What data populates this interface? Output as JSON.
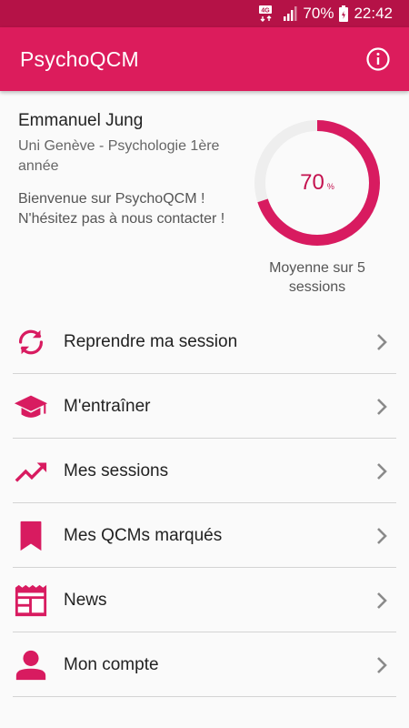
{
  "status_bar": {
    "network": "4G",
    "battery": "70%",
    "time": "22:42"
  },
  "app_bar": {
    "title": "PsychoQCM",
    "info_icon": "info-icon"
  },
  "profile": {
    "name": "Emmanuel Jung",
    "school": "Uni Genève - Psychologie 1ère année",
    "welcome": "Bienvenue sur PsychoQCM ! N'hésitez pas à nous contacter !"
  },
  "progress": {
    "value": 70,
    "unit": "%",
    "label": "Moyenne sur 5 sessions"
  },
  "menu": {
    "items": [
      {
        "label": "Reprendre ma session",
        "icon": "refresh-icon"
      },
      {
        "label": "M'entraîner",
        "icon": "graduation-cap-icon"
      },
      {
        "label": "Mes sessions",
        "icon": "trending-up-icon"
      },
      {
        "label": "Mes QCMs marqués",
        "icon": "bookmark-icon"
      },
      {
        "label": "News",
        "icon": "newspaper-icon"
      },
      {
        "label": "Mon compte",
        "icon": "person-icon"
      }
    ]
  },
  "colors": {
    "primary": "#dc1c5c",
    "primary_dark": "#b51247",
    "accent": "#d81b60",
    "track": "#eeeeee"
  }
}
